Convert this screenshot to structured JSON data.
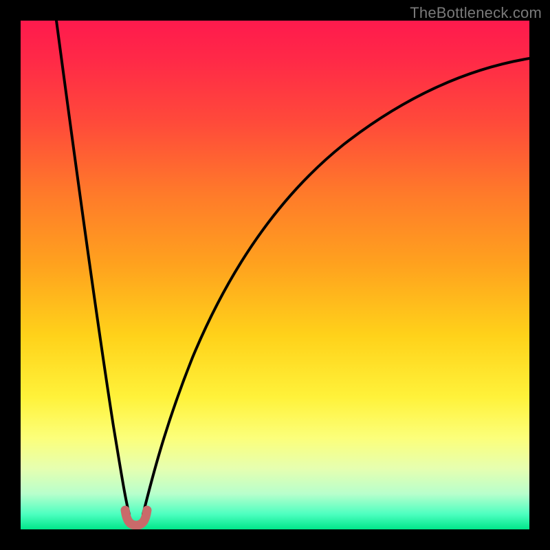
{
  "watermark": "TheBottleneck.com",
  "colors": {
    "frame_bg": "#000000",
    "curve_stroke": "#000000",
    "valley_marker": "#c96a6a",
    "gradient_top": "#ff1a4d",
    "gradient_bottom": "#00e68a"
  },
  "chart_data": {
    "type": "line",
    "title": "",
    "xlabel": "",
    "ylabel": "",
    "xlim": [
      0,
      100
    ],
    "ylim": [
      0,
      100
    ],
    "grid": false,
    "legend": false,
    "annotations": [
      "TheBottleneck.com"
    ],
    "description": "Bottleneck percentage curve. Y-axis: bottleneck % (0 at bottom, ~100 at top). X-axis: normalized component performance. Curve falls steeply from top-left to a minimum near x≈22 (bottleneck≈0) then rises with decreasing slope toward top-right (~85% at x=100). A short salmon segment marks the valley floor.",
    "series": [
      {
        "name": "bottleneck-curve",
        "x": [
          7,
          10,
          13,
          16,
          18,
          20,
          21,
          22,
          23,
          24,
          26,
          28,
          31,
          35,
          40,
          46,
          53,
          62,
          72,
          85,
          100
        ],
        "values": [
          100,
          80,
          60,
          40,
          25,
          12,
          5,
          1,
          1,
          4,
          12,
          22,
          33,
          44,
          53,
          61,
          68,
          74,
          79,
          82,
          85
        ]
      },
      {
        "name": "valley-marker",
        "x": [
          20.5,
          21.5,
          22,
          22.5,
          23.5
        ],
        "values": [
          2.5,
          0.5,
          0.3,
          0.5,
          2.5
        ]
      }
    ]
  }
}
